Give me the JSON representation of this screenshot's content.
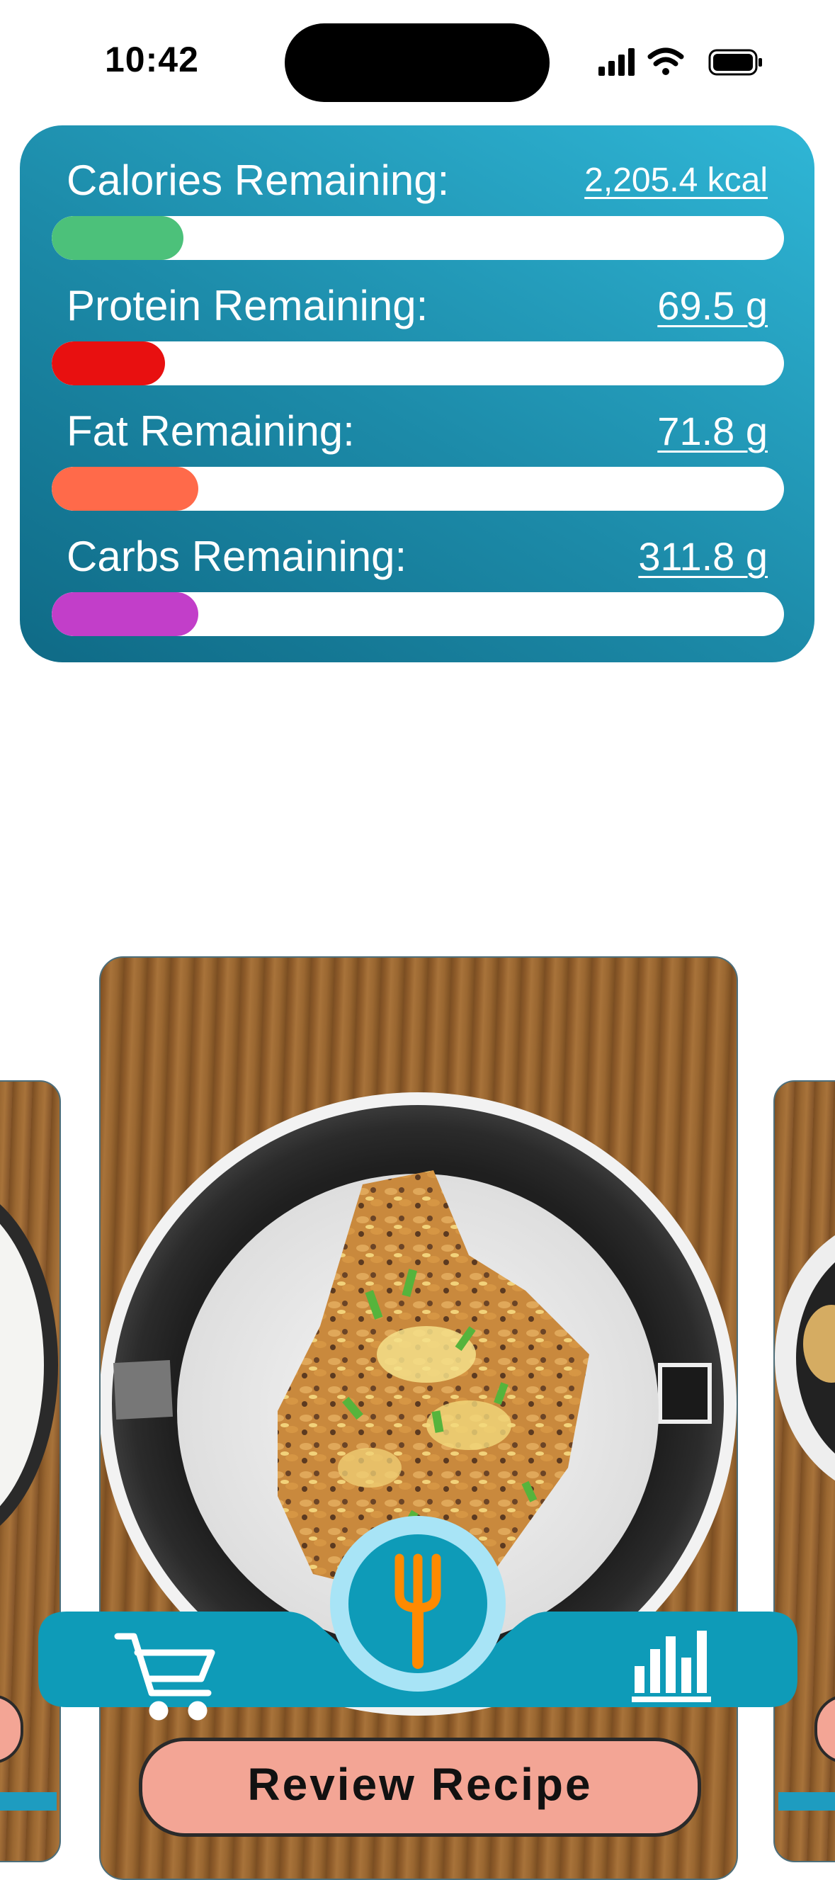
{
  "status_bar": {
    "time": "10:42",
    "icons": [
      "signal-icon",
      "wifi-icon",
      "battery-icon"
    ]
  },
  "macros": [
    {
      "label": "Calories Remaining:",
      "value": "2,205.4 kcal",
      "fill_fraction": 0.18,
      "color": "#4cc17a"
    },
    {
      "label": "Protein Remaining:",
      "value": "69.5 g",
      "fill_fraction": 0.155,
      "color": "#e81010"
    },
    {
      "label": "Fat Remaining:",
      "value": "71.8 g",
      "fill_fraction": 0.2,
      "color": "#ff6a4a"
    },
    {
      "label": "Carbs Remaining:",
      "value": "311.8 g",
      "fill_fraction": 0.2,
      "color": "#c23ec9"
    }
  ],
  "card": {
    "image": "plate-of-macaroni-photo"
  },
  "nav": {
    "left_icon": "cart-icon",
    "center_icon": "fork-icon",
    "right_icon": "bar-chart-icon",
    "bar_color": "#0e9bb8",
    "center_ring_color": "#a8e4f6",
    "fork_color": "#ff8a00"
  },
  "review_button": {
    "label": "Review Recipe"
  }
}
